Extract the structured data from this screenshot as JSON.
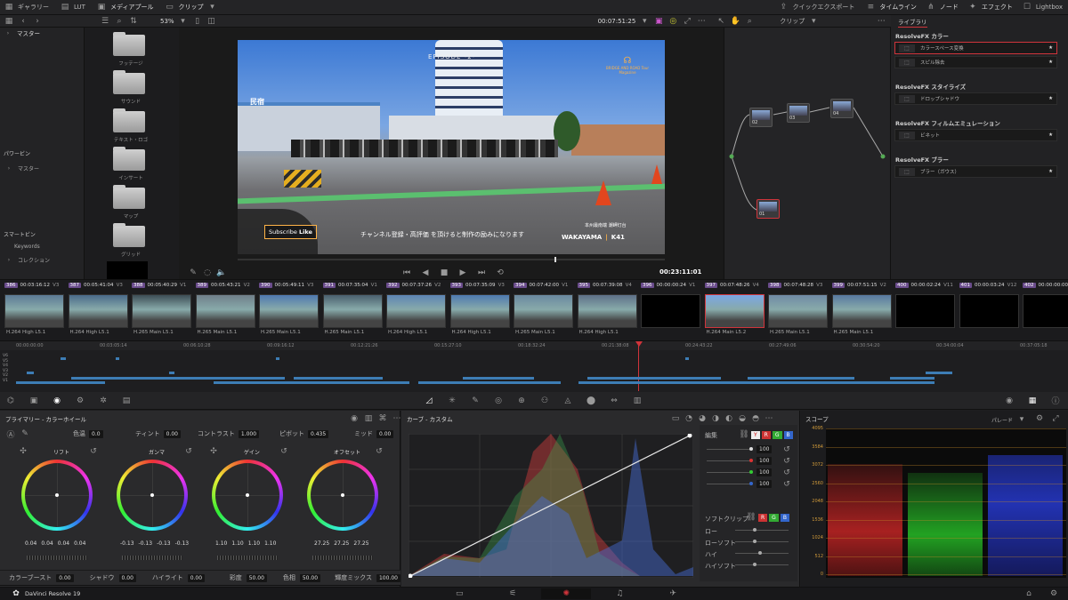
{
  "topbar": {
    "gallery": "ギャラリー",
    "lut": "LUT",
    "media_pool": "メディアプール",
    "clips": "クリップ",
    "quick_export": "クイックエクスポート",
    "timeline": "タイムライン",
    "nodes": "ノード",
    "effects": "エフェクト",
    "lightbox": "Lightbox"
  },
  "viewer_toolbar": {
    "zoom": "53%",
    "timecode": "00:07:51:25",
    "clip_label": "クリップ"
  },
  "media_panel": {
    "master": "マスター",
    "power_bin": "パワービン",
    "power_master": "マスター",
    "smart_bin": "スマートビン",
    "keywords": "Keywords",
    "collection": "コレクション",
    "folders": [
      "フッテージ",
      "サウンド",
      "テキスト・ロゴ",
      "インサート",
      "マップ",
      "グリッド"
    ]
  },
  "viewer": {
    "episode": "EPISODE -2-",
    "brand": "BRIDGE AND ROAD Tour Magazine",
    "subtitle": "チャンネル登録・高評価 を頂けると制作の励みになります",
    "subscribe": "Subscribe",
    "like": "Like",
    "location": "WAKAYAMA",
    "model": "K41",
    "sub_location": "本州最南端 潮岬灯台",
    "sign": "民宿",
    "end_timecode": "00:23:11:01"
  },
  "library": {
    "tab": "ライブラリ",
    "sections": [
      {
        "title": "ResolveFX カラー",
        "items": [
          {
            "label": "カラースペース変換",
            "selected": true
          },
          {
            "label": "スピル除去"
          }
        ]
      },
      {
        "title": "ResolveFX スタイライズ",
        "items": [
          {
            "label": "ドロップシャドウ"
          }
        ]
      },
      {
        "title": "ResolveFX フィルムエミュレーション",
        "items": [
          {
            "label": "ビネット"
          }
        ]
      },
      {
        "title": "ResolveFX ブラー",
        "items": [
          {
            "label": "ブラー（ガウス）"
          }
        ]
      }
    ]
  },
  "nodes": [
    {
      "label": "02"
    },
    {
      "label": "03"
    },
    {
      "label": "04"
    },
    {
      "label": "01"
    }
  ],
  "clips": [
    {
      "num": "386",
      "tc": "00:03:16:12",
      "track": "V3",
      "codec": "H.264 High L5.1"
    },
    {
      "num": "387",
      "tc": "00:05:41:04",
      "track": "V3",
      "codec": "H.264 High L5.1"
    },
    {
      "num": "388",
      "tc": "00:05:40:29",
      "track": "V1",
      "codec": "H.265 Main L5.1"
    },
    {
      "num": "389",
      "tc": "00:05:43:21",
      "track": "V2",
      "codec": "H.265 Main L5.1"
    },
    {
      "num": "390",
      "tc": "00:05:49:11",
      "track": "V3",
      "codec": "H.265 Main L5.1"
    },
    {
      "num": "391",
      "tc": "00:07:35:04",
      "track": "V1",
      "codec": "H.265 Main L5.1"
    },
    {
      "num": "392",
      "tc": "00:07:37:26",
      "track": "V2",
      "codec": "H.264 High L5.1"
    },
    {
      "num": "393",
      "tc": "00:07:35:09",
      "track": "V3",
      "codec": "H.264 High L5.1"
    },
    {
      "num": "394",
      "tc": "00:07:42:00",
      "track": "V1",
      "codec": "H.265 Main L5.1"
    },
    {
      "num": "395",
      "tc": "00:07:39:08",
      "track": "V4",
      "codec": "H.264 High L5.1"
    },
    {
      "num": "396",
      "tc": "00:00:00:24",
      "track": "V1",
      "codec": ""
    },
    {
      "num": "397",
      "tc": "00:07:48:26",
      "track": "V4",
      "codec": "H.264 Main L5.2"
    },
    {
      "num": "398",
      "tc": "00:07:48:28",
      "track": "V3",
      "codec": "H.265 Main L5.1"
    },
    {
      "num": "399",
      "tc": "00:07:51:15",
      "track": "V2",
      "codec": "H.265 Main L5.1"
    },
    {
      "num": "400",
      "tc": "00:00:02:24",
      "track": "V11",
      "codec": ""
    },
    {
      "num": "401",
      "tc": "00:00:03:24",
      "track": "V12",
      "codec": ""
    },
    {
      "num": "402",
      "tc": "00:00:00:00",
      "track": "",
      "codec": ""
    }
  ],
  "ruler": [
    "00:00:00:00",
    "00:03:05:14",
    "00:06:10:28",
    "00:09:16:12",
    "00:12:21:26",
    "00:15:27:10",
    "00:18:32:24",
    "00:21:38:08",
    "00:24:43:22",
    "00:27:49:06",
    "00:30:54:20",
    "00:34:00:04",
    "00:37:05:18"
  ],
  "tracks": [
    "V6",
    "V5",
    "V4",
    "V3",
    "V2",
    "V1"
  ],
  "primary": {
    "title": "プライマリー - カラーホイール",
    "temp_label": "色温",
    "temp": "0.0",
    "tint_label": "ティント",
    "tint": "0.00",
    "contrast_label": "コントラスト",
    "contrast": "1.000",
    "pivot_label": "ピボット",
    "pivot": "0.435",
    "mid_label": "ミッド",
    "mid": "0.00",
    "wheels": [
      {
        "name": "リフト",
        "vals": [
          "0.04",
          "0.04",
          "0.04",
          "0.04"
        ]
      },
      {
        "name": "ガンマ",
        "vals": [
          "-0.13",
          "-0.13",
          "-0.13",
          "-0.13"
        ]
      },
      {
        "name": "ゲイン",
        "vals": [
          "1.10",
          "1.10",
          "1.10",
          "1.10"
        ]
      },
      {
        "name": "オフセット",
        "vals": [
          "27.25",
          "27.25",
          "27.25"
        ]
      }
    ],
    "boost_label": "カラーブースト",
    "boost": "0.00",
    "shadow_label": "シャドウ",
    "shadow": "0.00",
    "highlight_label": "ハイライト",
    "highlight": "0.00",
    "sat_label": "彩度",
    "sat": "50.00",
    "hue_label": "色相",
    "hue": "50.00",
    "lummix_label": "輝度ミックス",
    "lummix": "100.00"
  },
  "curves": {
    "title": "カーブ - カスタム",
    "edit_label": "編集",
    "intensity": [
      "100",
      "100",
      "100",
      "100"
    ],
    "softclip_label": "ソフトクリップ",
    "low": "ロー",
    "low_soft": "ローソフト",
    "high": "ハイ",
    "high_soft": "ハイソフト",
    "y": "Y",
    "r": "R",
    "g": "G",
    "b": "B"
  },
  "scope": {
    "title": "スコープ",
    "mode": "パレード",
    "ticks": [
      "4095",
      "3584",
      "3072",
      "2560",
      "2048",
      "1536",
      "1024",
      "512",
      "0"
    ]
  },
  "bottombar": {
    "app": "DaVinci Resolve 19"
  },
  "colors": {
    "accent": "#d0343b",
    "track": "#3d7db5",
    "purple": "#6a4c8c"
  }
}
